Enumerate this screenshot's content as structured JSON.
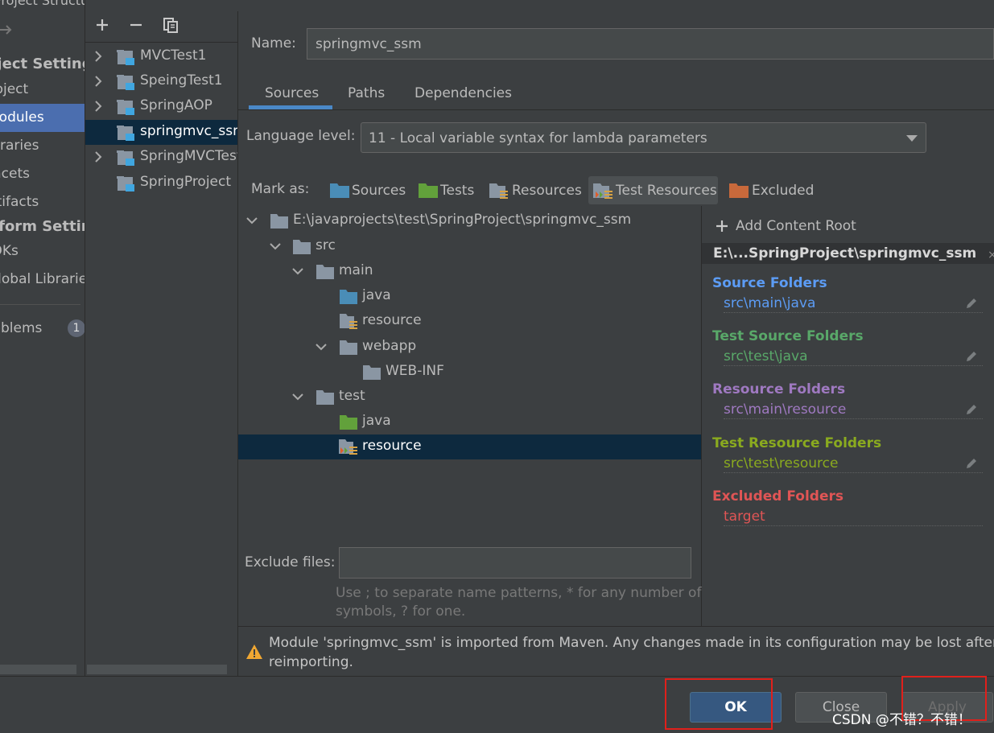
{
  "window": {
    "title": "Project Structure"
  },
  "nav": {
    "project_settings": "Project Settings",
    "items": [
      "Project",
      "Modules",
      "Libraries",
      "Facets",
      "Artifacts"
    ],
    "platform_settings": "Platform Settings",
    "platform_items": [
      "SDKs",
      "Global Libraries"
    ],
    "problems_label": "Problems",
    "problems_count": "1"
  },
  "modules_toolbar": {
    "add": "+",
    "remove": "−",
    "copy": "copy-icon"
  },
  "modules": [
    {
      "name": "MVCTest1",
      "expandable": true
    },
    {
      "name": "SpeingTest1",
      "expandable": true
    },
    {
      "name": "SpringAOP",
      "expandable": true
    },
    {
      "name": "springmvc_ssm",
      "expandable": false,
      "selected": true
    },
    {
      "name": "SpringMVCTest",
      "expandable": true
    },
    {
      "name": "SpringProject",
      "expandable": false
    }
  ],
  "name_field": {
    "label": "Name:",
    "value": "springmvc_ssm"
  },
  "tabs": [
    "Sources",
    "Paths",
    "Dependencies"
  ],
  "active_tab": "Sources",
  "language_level": {
    "label": "Language level:",
    "value": "11 - Local variable syntax for lambda parameters"
  },
  "mark_as": {
    "label": "Mark as:",
    "buttons": [
      "Sources",
      "Tests",
      "Resources",
      "Test Resources",
      "Excluded"
    ],
    "active": "Test Resources"
  },
  "tree": [
    {
      "label": "E:\\javaprojects\\test\\SpringProject\\springmvc_ssm",
      "kind": "plain"
    },
    {
      "label": "src",
      "kind": "plain"
    },
    {
      "label": "main",
      "kind": "plain"
    },
    {
      "label": "java",
      "kind": "source"
    },
    {
      "label": "resource",
      "kind": "resource"
    },
    {
      "label": "webapp",
      "kind": "plain"
    },
    {
      "label": "WEB-INF",
      "kind": "plain"
    },
    {
      "label": "test",
      "kind": "plain"
    },
    {
      "label": "java",
      "kind": "test"
    },
    {
      "label": "resource",
      "kind": "test-resource",
      "selected": true
    }
  ],
  "right_pane": {
    "add_root": "Add Content Root",
    "root_path": "E:\\...SpringProject\\springmvc_ssm",
    "groups": [
      {
        "title": "Source Folders",
        "value": "src\\main\\java",
        "color": "#5c9cf5"
      },
      {
        "title": "Test Source Folders",
        "value": "src\\test\\java",
        "color": "#59a869"
      },
      {
        "title": "Resource Folders",
        "value": "src\\main\\resource",
        "color": "#9f79c1"
      },
      {
        "title": "Test Resource Folders",
        "value": "src\\test\\resource",
        "color": "#8aaa1f"
      },
      {
        "title": "Excluded Folders",
        "value": "target",
        "color": "#e05555"
      }
    ]
  },
  "exclude_files": {
    "label": "Exclude files:",
    "value": "",
    "hint_line1": "Use ; to separate name patterns, * for any number of",
    "hint_line2": "symbols, ? for one."
  },
  "warning": {
    "line1": "Module 'springmvc_ssm' is imported from Maven. Any changes made in its configuration may be lost after",
    "line2": "reimporting."
  },
  "buttons": {
    "ok": "OK",
    "close": "Close",
    "apply": "Apply"
  },
  "watermark": "CSDN @不错？不错！",
  "colors": {
    "accent": "#4b6eaf",
    "selection": "#0d293e",
    "highlight_box": "#e0201b"
  }
}
